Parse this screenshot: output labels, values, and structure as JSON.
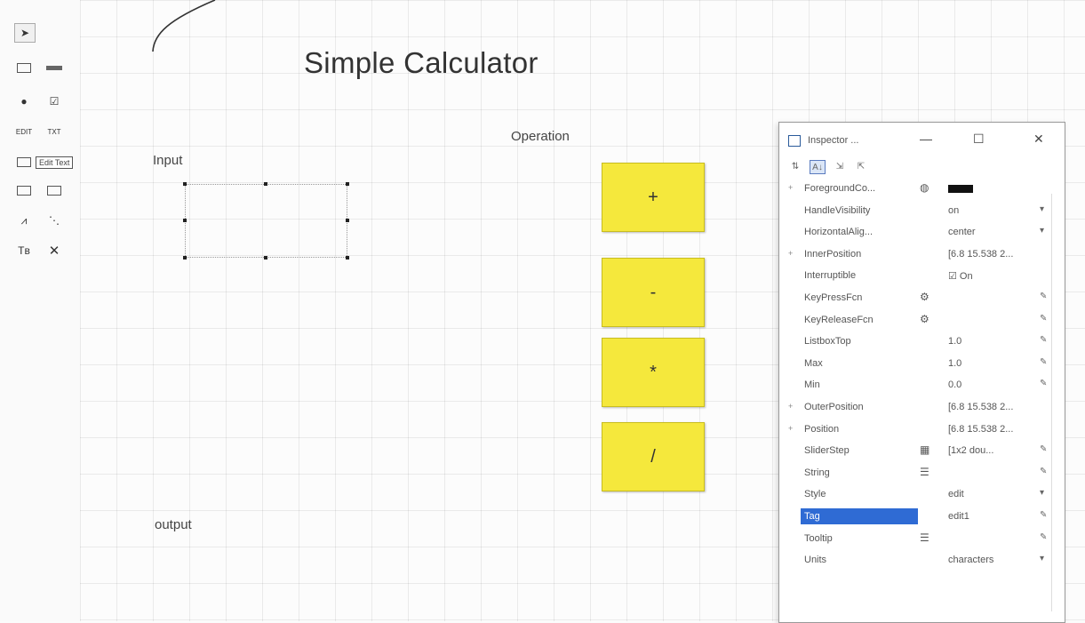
{
  "palette": {
    "tooltip": "Edit Text",
    "icons": [
      {
        "name": "pointer-tool-icon",
        "glyph": "➤"
      },
      {
        "name": "push-button-tool-icon",
        "glyph": "OK"
      },
      {
        "name": "slider-tool-icon",
        "glyph": ""
      },
      {
        "name": "radio-button-tool-icon",
        "glyph": "●"
      },
      {
        "name": "checkbox-tool-icon",
        "glyph": "☑"
      },
      {
        "name": "edit-text-tool-icon",
        "glyph": "EDIT"
      },
      {
        "name": "static-text-tool-icon",
        "glyph": "TXT"
      },
      {
        "name": "popup-menu-tool-icon",
        "glyph": ""
      },
      {
        "name": "listbox-tool-icon",
        "glyph": ""
      },
      {
        "name": "toggle-button-tool-icon",
        "glyph": ""
      },
      {
        "name": "table-tool-icon",
        "glyph": ""
      },
      {
        "name": "axes-tool-icon",
        "glyph": "⩘"
      },
      {
        "name": "panel-tool-icon",
        "glyph": "⋱"
      },
      {
        "name": "button-group-tool-icon",
        "glyph": "Tʙ"
      },
      {
        "name": "activex-tool-icon",
        "glyph": "✕"
      }
    ]
  },
  "canvas": {
    "title": "Simple Calculator",
    "input_label": "Input",
    "output_label": "output",
    "operation_label": "Operation",
    "buttons": [
      "+",
      "-",
      "*",
      "/"
    ]
  },
  "inspector": {
    "title": "Inspector ...",
    "minimize": "—",
    "maximize": "☐",
    "close": "✕",
    "toolbar": [
      "⇅",
      "A↓",
      "⇲",
      "⇱"
    ],
    "properties": [
      {
        "name": "ForegroundCo...",
        "expand": "+",
        "icon": "◍",
        "value": "",
        "swatch": true,
        "action": ""
      },
      {
        "name": "HandleVisibility",
        "expand": "",
        "icon": "",
        "value": "on",
        "action": "▾"
      },
      {
        "name": "HorizontalAlig...",
        "expand": "",
        "icon": "",
        "value": "center",
        "action": "▾"
      },
      {
        "name": "InnerPosition",
        "expand": "+",
        "icon": "",
        "value": "[6.8 15.538 2...",
        "action": ""
      },
      {
        "name": "Interruptible",
        "expand": "",
        "icon": "",
        "value": "☑ On",
        "action": ""
      },
      {
        "name": "KeyPressFcn",
        "expand": "",
        "icon": "⚙",
        "value": "",
        "action": "✎"
      },
      {
        "name": "KeyReleaseFcn",
        "expand": "",
        "icon": "⚙",
        "value": "",
        "action": "✎"
      },
      {
        "name": "ListboxTop",
        "expand": "",
        "icon": "",
        "value": "1.0",
        "action": "✎"
      },
      {
        "name": "Max",
        "expand": "",
        "icon": "",
        "value": "1.0",
        "action": "✎"
      },
      {
        "name": "Min",
        "expand": "",
        "icon": "",
        "value": "0.0",
        "action": "✎"
      },
      {
        "name": "OuterPosition",
        "expand": "+",
        "icon": "",
        "value": "[6.8 15.538 2...",
        "action": ""
      },
      {
        "name": "Position",
        "expand": "+",
        "icon": "",
        "value": "[6.8 15.538 2...",
        "action": ""
      },
      {
        "name": "SliderStep",
        "expand": "",
        "icon": "▦",
        "value": "[1x2 dou...",
        "action": "✎"
      },
      {
        "name": "String",
        "expand": "",
        "icon": "☰",
        "value": "",
        "action": "✎"
      },
      {
        "name": "Style",
        "expand": "",
        "icon": "",
        "value": "edit",
        "action": "▾"
      },
      {
        "name": "Tag",
        "expand": "",
        "icon": "",
        "value": "edit1",
        "action": "✎",
        "selected": true
      },
      {
        "name": "Tooltip",
        "expand": "",
        "icon": "☰",
        "value": "",
        "action": "✎"
      },
      {
        "name": "Units",
        "expand": "",
        "icon": "",
        "value": "characters",
        "action": "▾"
      }
    ]
  },
  "colors": {
    "button_fill": "#f5e83c",
    "selection": "#2f6bd4"
  }
}
